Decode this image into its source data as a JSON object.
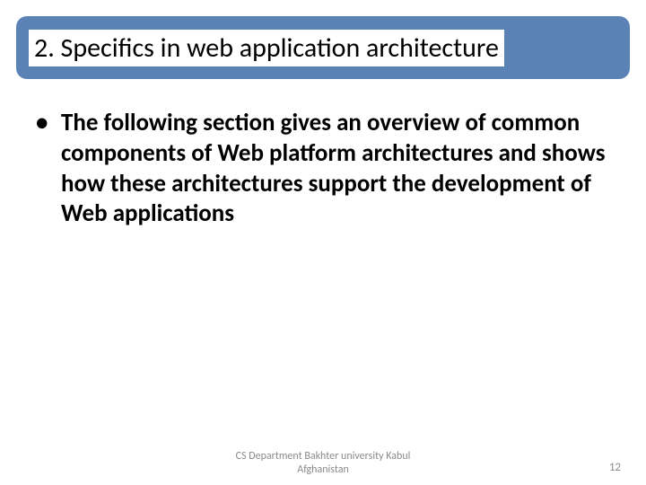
{
  "title": "2. Specifics in web application architecture",
  "bullets": [
    " The following section gives an overview of common components of Web platform architectures and shows how these architectures support the development of Web applications"
  ],
  "footer": {
    "line1": "CS Department Bakhter university Kabul",
    "line2": "Afghanistan"
  },
  "page_number": "12"
}
